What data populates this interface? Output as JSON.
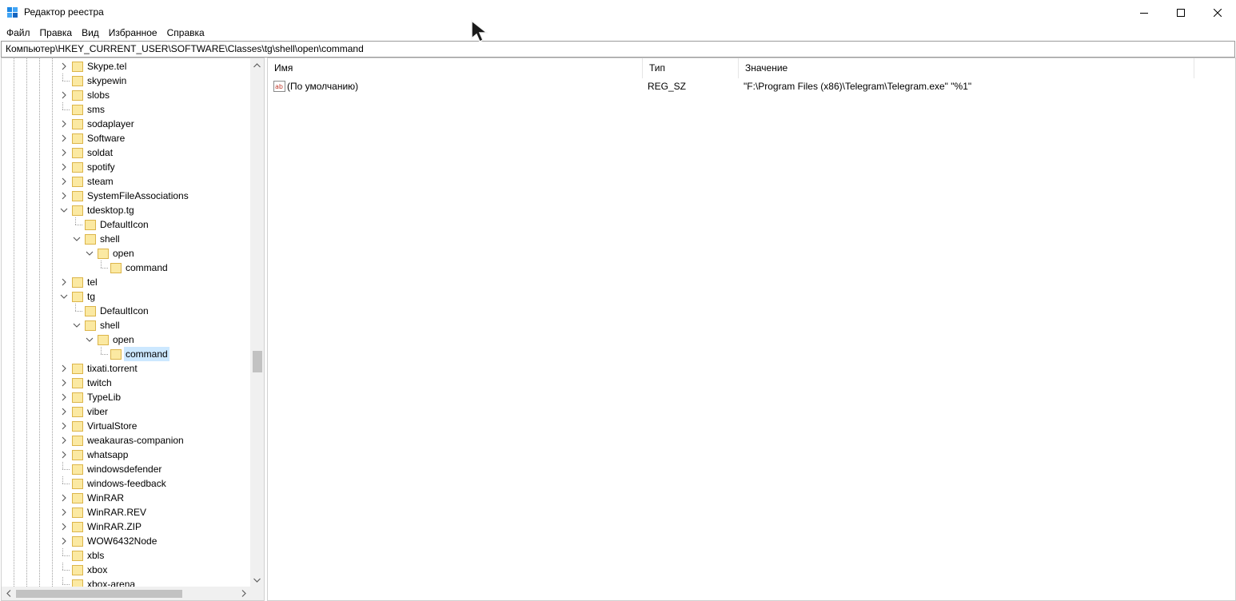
{
  "window": {
    "title": "Редактор реестра",
    "controls": {
      "minimize": "minimize-icon",
      "maximize": "maximize-icon",
      "close": "close-icon"
    }
  },
  "menu": [
    "Файл",
    "Правка",
    "Вид",
    "Избранное",
    "Справка"
  ],
  "address": "Компьютер\\HKEY_CURRENT_USER\\SOFTWARE\\Classes\\tg\\shell\\open\\command",
  "tree": [
    {
      "label": "Skype.tel",
      "level": 0,
      "state": "collapsed"
    },
    {
      "label": "skypewin",
      "level": 0,
      "state": "leaf"
    },
    {
      "label": "slobs",
      "level": 0,
      "state": "collapsed"
    },
    {
      "label": "sms",
      "level": 0,
      "state": "leaf"
    },
    {
      "label": "sodaplayer",
      "level": 0,
      "state": "collapsed"
    },
    {
      "label": "Software",
      "level": 0,
      "state": "collapsed"
    },
    {
      "label": "soldat",
      "level": 0,
      "state": "collapsed"
    },
    {
      "label": "spotify",
      "level": 0,
      "state": "collapsed"
    },
    {
      "label": "steam",
      "level": 0,
      "state": "collapsed"
    },
    {
      "label": "SystemFileAssociations",
      "level": 0,
      "state": "collapsed"
    },
    {
      "label": "tdesktop.tg",
      "level": 0,
      "state": "expanded"
    },
    {
      "label": "DefaultIcon",
      "level": 1,
      "state": "leaf"
    },
    {
      "label": "shell",
      "level": 1,
      "state": "expanded"
    },
    {
      "label": "open",
      "level": 2,
      "state": "expanded"
    },
    {
      "label": "command",
      "level": 3,
      "state": "leaf"
    },
    {
      "label": "tel",
      "level": 0,
      "state": "collapsed"
    },
    {
      "label": "tg",
      "level": 0,
      "state": "expanded"
    },
    {
      "label": "DefaultIcon",
      "level": 1,
      "state": "leaf"
    },
    {
      "label": "shell",
      "level": 1,
      "state": "expanded"
    },
    {
      "label": "open",
      "level": 2,
      "state": "expanded"
    },
    {
      "label": "command",
      "level": 3,
      "state": "leaf",
      "selected": true
    },
    {
      "label": "tixati.torrent",
      "level": 0,
      "state": "collapsed"
    },
    {
      "label": "twitch",
      "level": 0,
      "state": "collapsed"
    },
    {
      "label": "TypeLib",
      "level": 0,
      "state": "collapsed"
    },
    {
      "label": "viber",
      "level": 0,
      "state": "collapsed"
    },
    {
      "label": "VirtualStore",
      "level": 0,
      "state": "collapsed"
    },
    {
      "label": "weakauras-companion",
      "level": 0,
      "state": "collapsed"
    },
    {
      "label": "whatsapp",
      "level": 0,
      "state": "collapsed"
    },
    {
      "label": "windowsdefender",
      "level": 0,
      "state": "leaf"
    },
    {
      "label": "windows-feedback",
      "level": 0,
      "state": "leaf"
    },
    {
      "label": "WinRAR",
      "level": 0,
      "state": "collapsed"
    },
    {
      "label": "WinRAR.REV",
      "level": 0,
      "state": "collapsed"
    },
    {
      "label": "WinRAR.ZIP",
      "level": 0,
      "state": "collapsed"
    },
    {
      "label": "WOW6432Node",
      "level": 0,
      "state": "collapsed"
    },
    {
      "label": "xbls",
      "level": 0,
      "state": "leaf"
    },
    {
      "label": "xbox",
      "level": 0,
      "state": "leaf"
    },
    {
      "label": "xbox-arena",
      "level": 0,
      "state": "leaf"
    }
  ],
  "list": {
    "columns": [
      "Имя",
      "Тип",
      "Значение"
    ],
    "rows": [
      {
        "name": "(По умолчанию)",
        "type": "REG_SZ",
        "value": "\"F:\\Program Files (x86)\\Telegram\\Telegram.exe\" \"%1\"",
        "icon": "string-value-icon"
      }
    ]
  },
  "colors": {
    "selection": "#cce8ff",
    "folder": "#fbe9a2",
    "folder_border": "#dcb54a"
  }
}
